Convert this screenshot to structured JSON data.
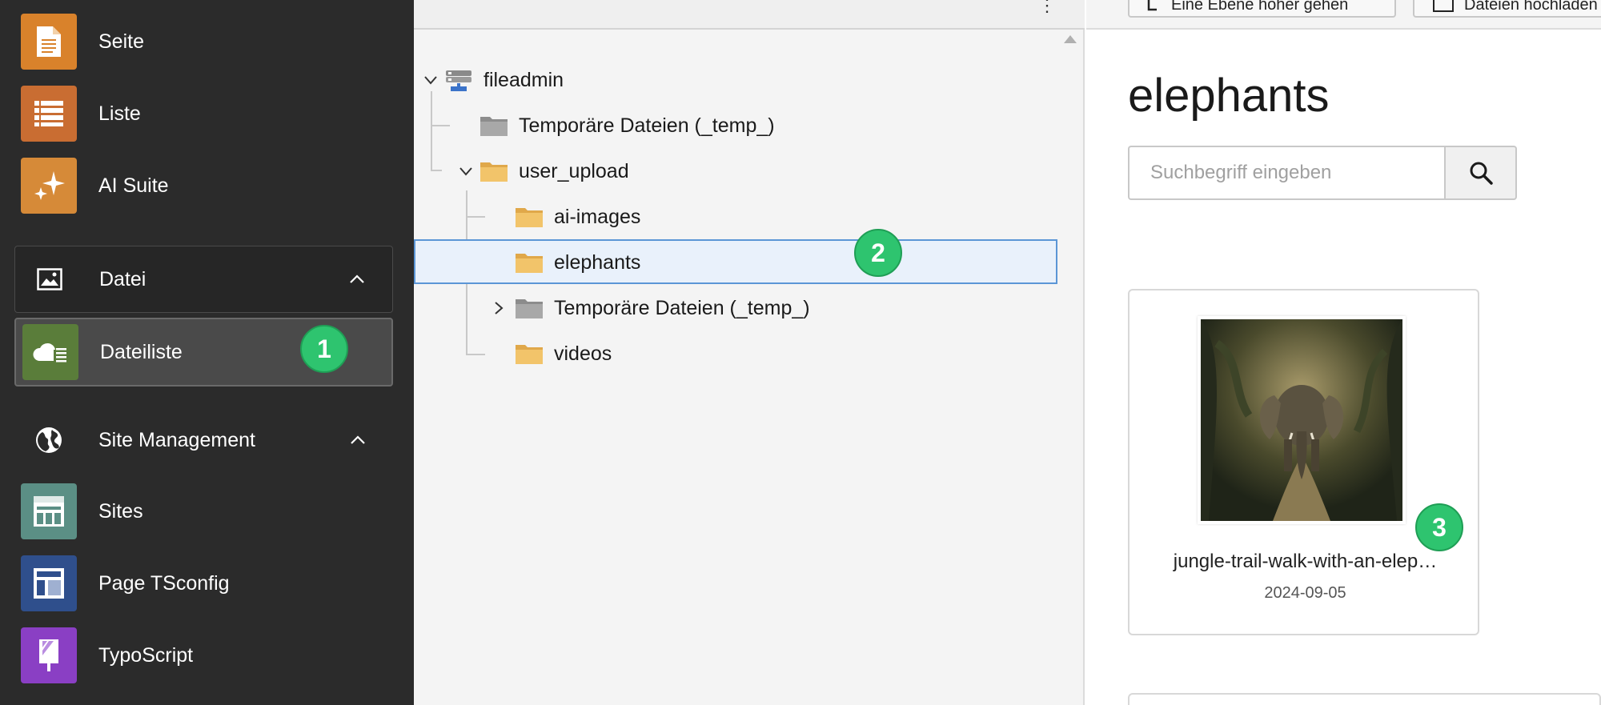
{
  "sidebar": {
    "modules_top": [
      {
        "label": "Seite",
        "icon": "page-icon",
        "color": "#d9822b"
      },
      {
        "label": "Liste",
        "icon": "list-icon",
        "color": "#c96d32"
      },
      {
        "label": "AI Suite",
        "icon": "sparkles-icon",
        "color": "#d68a38"
      }
    ],
    "group_datei": {
      "label": "Datei",
      "icon": "image-icon"
    },
    "active_module": {
      "label": "Dateiliste",
      "icon": "cloud-list-icon",
      "color": "#5a7d3a"
    },
    "group_site": {
      "label": "Site Management",
      "icon": "globe-icon"
    },
    "modules_site": [
      {
        "label": "Sites",
        "icon": "sites-icon",
        "color": "#5b8f85"
      },
      {
        "label": "Page TSconfig",
        "icon": "layout-icon",
        "color": "#2f4f8c"
      },
      {
        "label": "TypoScript",
        "icon": "typoscript-icon",
        "color": "#8a3fc4"
      }
    ]
  },
  "badges": {
    "one": "1",
    "two": "2",
    "three": "3"
  },
  "tree": {
    "root": "fileadmin",
    "items": [
      {
        "label": "Temporäre Dateien (_temp_)"
      },
      {
        "label": "user_upload"
      },
      {
        "label": "ai-images"
      },
      {
        "label": "elephants"
      },
      {
        "label": "Temporäre Dateien (_temp_)"
      },
      {
        "label": "videos"
      }
    ]
  },
  "content": {
    "toolbar": {
      "up_label": "Eine Ebene höher gehen",
      "upload_label": "Dateien hochladen"
    },
    "title": "elephants",
    "search": {
      "placeholder": "Suchbegriff eingeben",
      "value": ""
    },
    "file": {
      "name": "jungle-trail-walk-with-an-elep…",
      "date": "2024-09-05"
    }
  },
  "colors": {
    "accent_badge": "#2ec46f",
    "selection_border": "#5b96d6",
    "selection_bg": "#e9f1fb"
  }
}
